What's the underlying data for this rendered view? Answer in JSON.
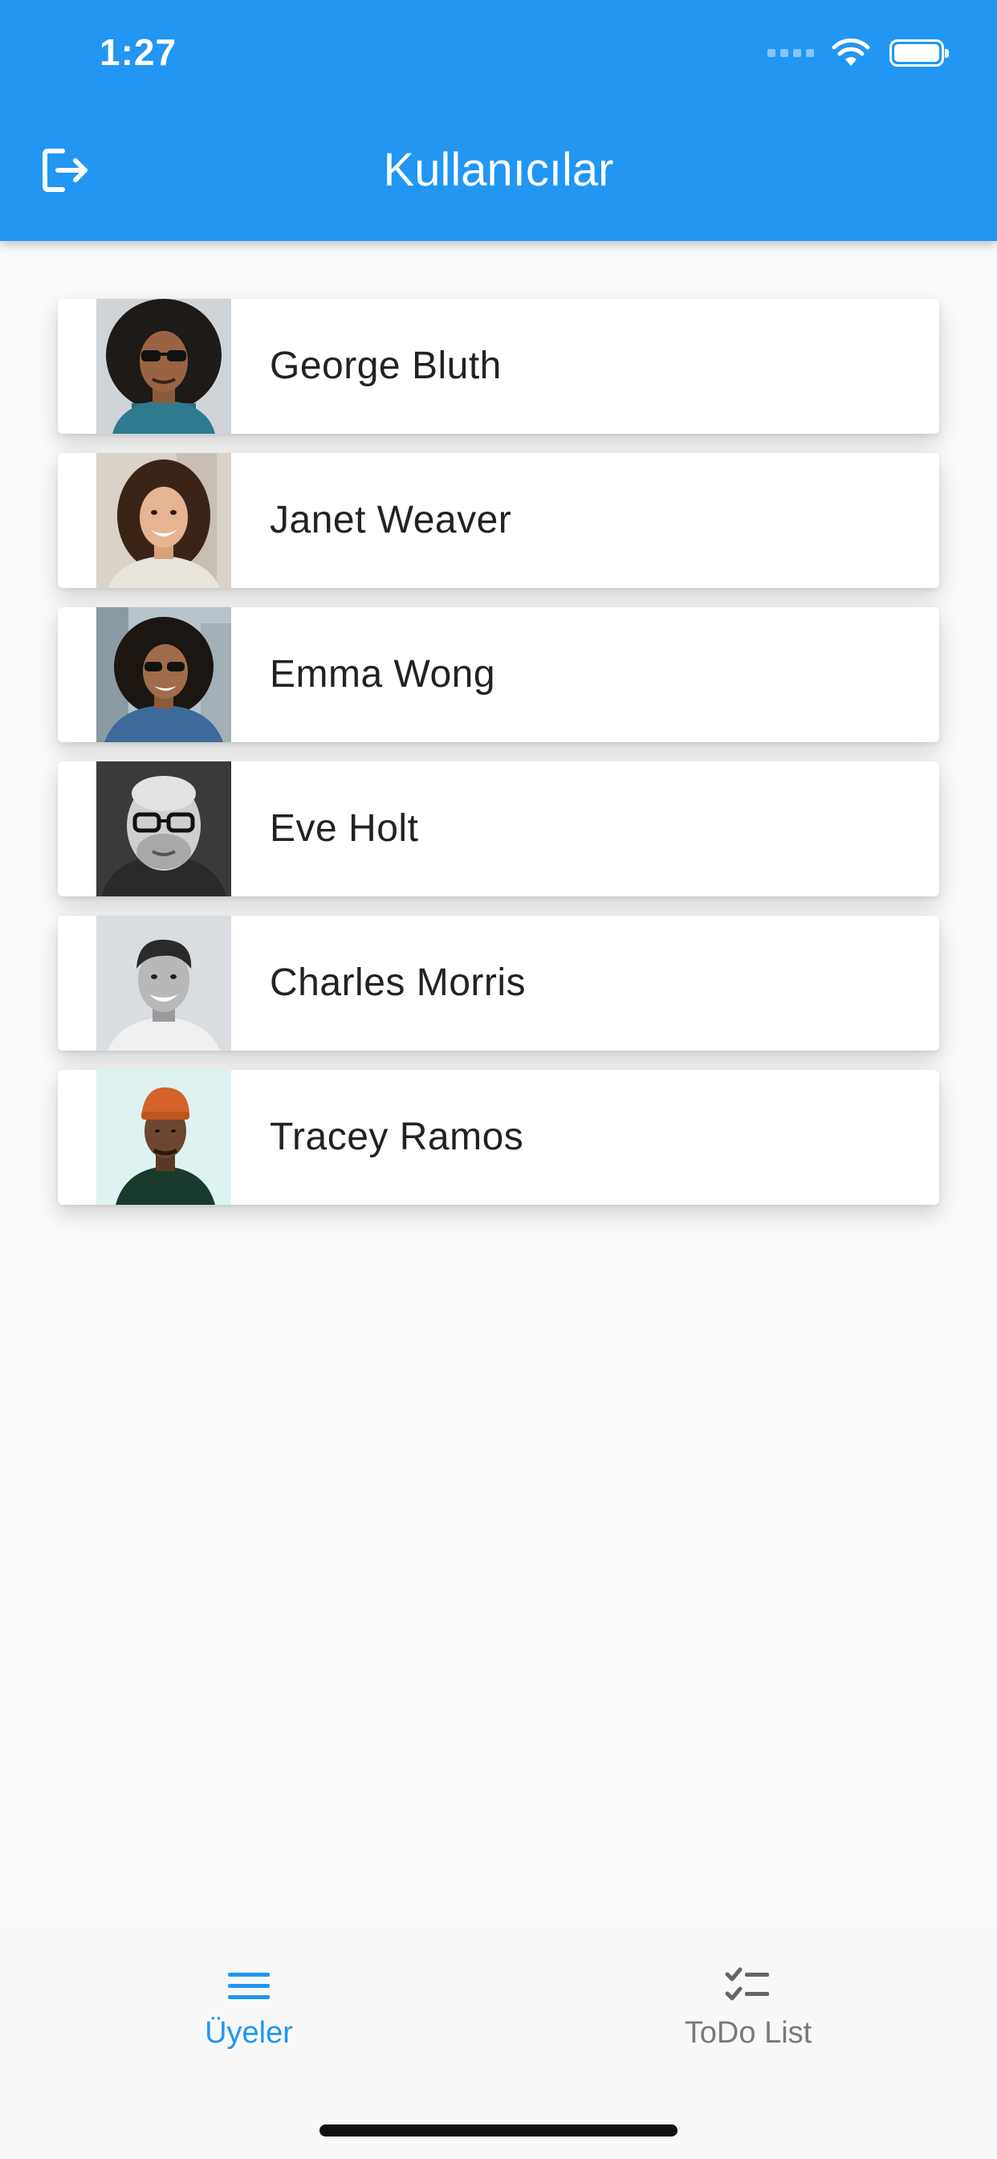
{
  "status_bar": {
    "time": "1:27",
    "icons": [
      "signal-icon",
      "wifi-icon",
      "battery-icon"
    ]
  },
  "header": {
    "title": "Kullanıcılar",
    "left_icon": "logout-icon",
    "background_color": "#2196f3"
  },
  "users": [
    {
      "name": "George Bluth",
      "avatar_icon": "avatar-photo"
    },
    {
      "name": "Janet Weaver",
      "avatar_icon": "avatar-photo"
    },
    {
      "name": "Emma Wong",
      "avatar_icon": "avatar-photo"
    },
    {
      "name": "Eve Holt",
      "avatar_icon": "avatar-photo"
    },
    {
      "name": "Charles Morris",
      "avatar_icon": "avatar-photo"
    },
    {
      "name": "Tracey Ramos",
      "avatar_icon": "avatar-photo"
    }
  ],
  "bottom_nav": {
    "tabs": [
      {
        "label": "Üyeler",
        "icon": "menu-lines-icon",
        "active": true
      },
      {
        "label": "ToDo List",
        "icon": "checklist-icon",
        "active": false
      }
    ],
    "active_color": "#2196f3",
    "inactive_color": "#7a7a7a"
  }
}
